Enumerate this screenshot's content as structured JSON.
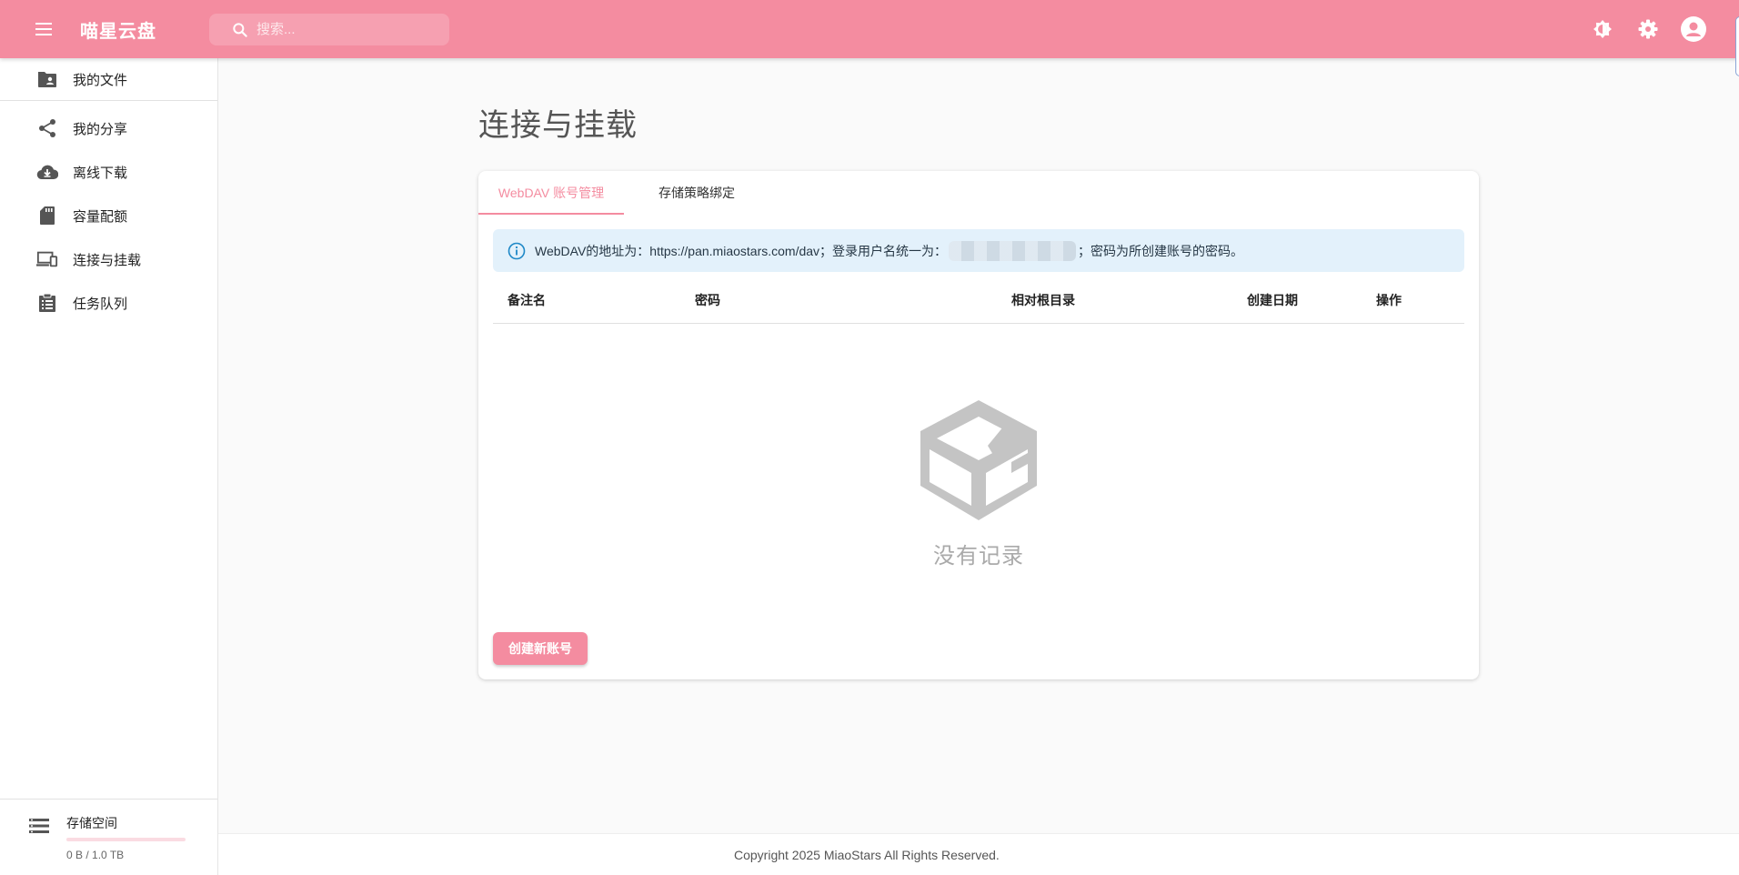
{
  "app": {
    "title": "喵星云盘"
  },
  "search": {
    "placeholder": "搜索..."
  },
  "sidebar": {
    "items": [
      {
        "label": "我的文件",
        "icon": "folder-account-icon"
      },
      {
        "label": "我的分享",
        "icon": "share-icon"
      },
      {
        "label": "离线下载",
        "icon": "cloud-download-icon"
      },
      {
        "label": "容量配额",
        "icon": "sd-card-icon"
      },
      {
        "label": "连接与挂载",
        "icon": "devices-icon"
      },
      {
        "label": "任务队列",
        "icon": "clipboard-list-icon"
      }
    ],
    "storage": {
      "title": "存储空间",
      "usage": "0 B / 1.0 TB",
      "used_fraction": 0
    }
  },
  "main": {
    "title": "连接与挂载",
    "tabs": [
      {
        "label": "WebDAV 账号管理"
      },
      {
        "label": "存储策略绑定"
      }
    ],
    "alert": {
      "prefix": "WebDAV的地址为：https://pan.miaostars.com/dav；登录用户名统一为：",
      "suffix": "；密码为所创建账号的密码。"
    },
    "table": {
      "headers": [
        "备注名",
        "密码",
        "相对根目录",
        "创建日期",
        "操作"
      ]
    },
    "empty_text": "没有记录",
    "create_button": "创建新账号"
  },
  "footer": {
    "copyright": "Copyright 2025 MiaoStars All Rights Reserved."
  },
  "colors": {
    "accent": "#f48ca0",
    "info_bg": "#e3f1fb",
    "info_icon": "#1e88c7"
  }
}
